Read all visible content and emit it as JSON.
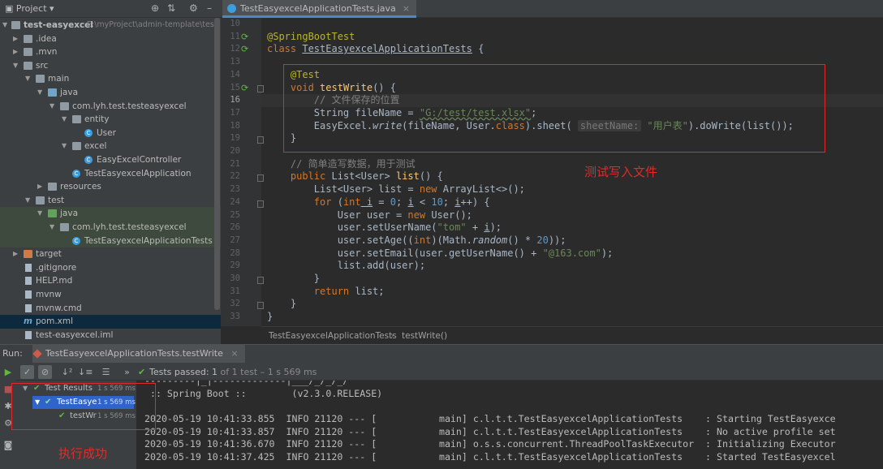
{
  "project_panel": {
    "title": "Project",
    "root_name": "test-easyexcel",
    "root_path": "E:\\myProject\\admin-template\\test-",
    "tree": [
      {
        "label": ".idea"
      },
      {
        "label": ".mvn"
      },
      {
        "label": "src"
      },
      {
        "label": "main"
      },
      {
        "label": "java"
      },
      {
        "label": "com.lyh.test.testeasyexcel"
      },
      {
        "label": "entity"
      },
      {
        "label": "User"
      },
      {
        "label": "excel"
      },
      {
        "label": "EasyExcelController"
      },
      {
        "label": "TestEasyexcelApplication"
      },
      {
        "label": "resources"
      },
      {
        "label": "test"
      },
      {
        "label": "java"
      },
      {
        "label": "com.lyh.test.testeasyexcel"
      },
      {
        "label": "TestEasyexcelApplicationTests"
      },
      {
        "label": "target"
      },
      {
        "label": ".gitignore"
      },
      {
        "label": "HELP.md"
      },
      {
        "label": "mvnw"
      },
      {
        "label": "mvnw.cmd"
      },
      {
        "label": "pom.xml"
      },
      {
        "label": "test-easyexcel.iml"
      }
    ]
  },
  "editor": {
    "tab_label": "TestEasyexcelApplicationTests.java",
    "tab_close": "×",
    "line_numbers": [
      "10",
      "11",
      "12",
      "13",
      "14",
      "15",
      "16",
      "17",
      "18",
      "19",
      "20",
      "21",
      "22",
      "23",
      "24",
      "25",
      "26",
      "27",
      "28",
      "29",
      "30",
      "31",
      "32",
      "33"
    ],
    "code": {
      "l11_annotation": "@SpringBootTest",
      "l12_kw": "class",
      "l12_name": "TestEasyexcelApplicationTests",
      "l12_brace": "{",
      "l14_annotation": "@Test",
      "l15_kw": "void",
      "l15_name": "testWrite",
      "l15_rest": "() {",
      "l16_comment": "// 文件保存的位置",
      "l17_type": "String fileName = ",
      "l17_str": "\"G:/test/test.xlsx\"",
      "l17_end": ";",
      "l18_pre": "EasyExcel.",
      "l18_write": "write",
      "l18_mid": "(fileName, User.",
      "l18_class_kw": "class",
      "l18_sheet": ").sheet(",
      "l18_param": "sheetName:",
      "l18_str": "\"用户表\"",
      "l18_end": ").doWrite(list());",
      "l19_brace": "}",
      "l21_comment": "// 简单造写数据，用于测试",
      "l22_kw": "public",
      "l22_type": " List<User> ",
      "l22_name": "list",
      "l22_rest": "() {",
      "l23_pre": "List<User> list = ",
      "l23_kw": "new",
      "l23_rest": " ArrayList<>();",
      "l24_kw": "for",
      "l24_p1": " (",
      "l24_int": "int",
      "l24_i1": " i",
      "l24_p2": " = ",
      "l24_n0": "0",
      "l24_p3": "; ",
      "l24_i2": "i",
      "l24_p4": " < ",
      "l24_n10": "10",
      "l24_p5": "; ",
      "l24_i3": "i",
      "l24_p6": "++) {",
      "l25_pre": "User user = ",
      "l25_kw": "new",
      "l25_rest": " User();",
      "l26_pre": "user.setUserName(",
      "l26_str": "\"tom\"",
      "l26_mid": " + ",
      "l26_i": "i",
      "l26_end": ");",
      "l27_pre": "user.setAge((",
      "l27_int": "int",
      "l27_mid": ")(Math.",
      "l27_random": "random",
      "l27_mid2": "() * ",
      "l27_num": "20",
      "l27_end": "));",
      "l28_pre": "user.setEmail(user.getUserName() + ",
      "l28_str": "\"@163.com\"",
      "l28_end": ");",
      "l29": "list.add(user);",
      "l30": "}",
      "l31_kw": "return",
      "l31_rest": " list;",
      "l32": "}",
      "l33": "}"
    },
    "annotation_label": "测试写入文件",
    "breadcrumb": [
      "TestEasyexcelApplicationTests",
      "testWrite()"
    ]
  },
  "run_panel": {
    "label": "Run:",
    "tab_label": "TestEasyexcelApplicationTests.testWrite",
    "tab_close": "×",
    "status_prefix": "Tests passed:",
    "status_count": "1",
    "status_rest": "of 1 test – 1 s 569 ms",
    "tree": [
      {
        "label": "Test Results",
        "time": "1 s 569 ms"
      },
      {
        "label": "TestEasye",
        "time": "1 s 569 ms"
      },
      {
        "label": "testWr",
        "time": "1 s 569 ms"
      }
    ],
    "console_lines": [
      "---------|_|-------------|___/_/_/_/",
      " :: Spring Boot ::        (v2.3.0.RELEASE)",
      "",
      "2020-05-19 10:41:33.855  INFO 21120 --- [           main] c.l.t.t.TestEasyexcelApplicationTests    : Starting TestEasyexce",
      "2020-05-19 10:41:33.857  INFO 21120 --- [           main] c.l.t.t.TestEasyexcelApplicationTests    : No active profile set",
      "2020-05-19 10:41:36.670  INFO 21120 --- [           main] o.s.s.concurrent.ThreadPoolTaskExecutor  : Initializing Executor",
      "2020-05-19 10:41:37.425  INFO 21120 --- [           main] c.l.t.t.TestEasyexcelApplicationTests    : Started TestEasyexcel"
    ],
    "annotation_label": "执行成功"
  }
}
